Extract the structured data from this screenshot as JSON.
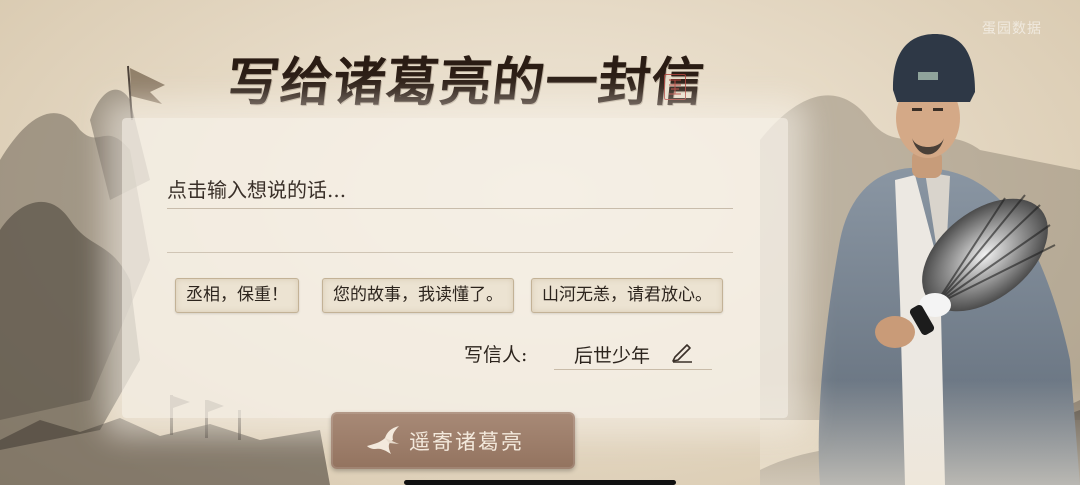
{
  "app": {
    "title": "写给诸葛亮的一封信",
    "seal_text": "",
    "watermark": "蛋园数据"
  },
  "letter": {
    "input_placeholder": "点击输入想说的话..."
  },
  "suggestions": [
    "丞相，保重！",
    "您的故事，我读懂了。",
    "山河无恙，请君放心。"
  ],
  "sender": {
    "label": "写信人:",
    "value": "后世少年"
  },
  "send_button": {
    "label": "遥寄诸葛亮"
  },
  "colors": {
    "paper": "#f6f1e8",
    "ink": "#2a1c14",
    "button": "#9c7d69",
    "seal": "#b0413a"
  },
  "icons": {
    "pencil": "pencil-icon",
    "crane": "crane-icon"
  }
}
